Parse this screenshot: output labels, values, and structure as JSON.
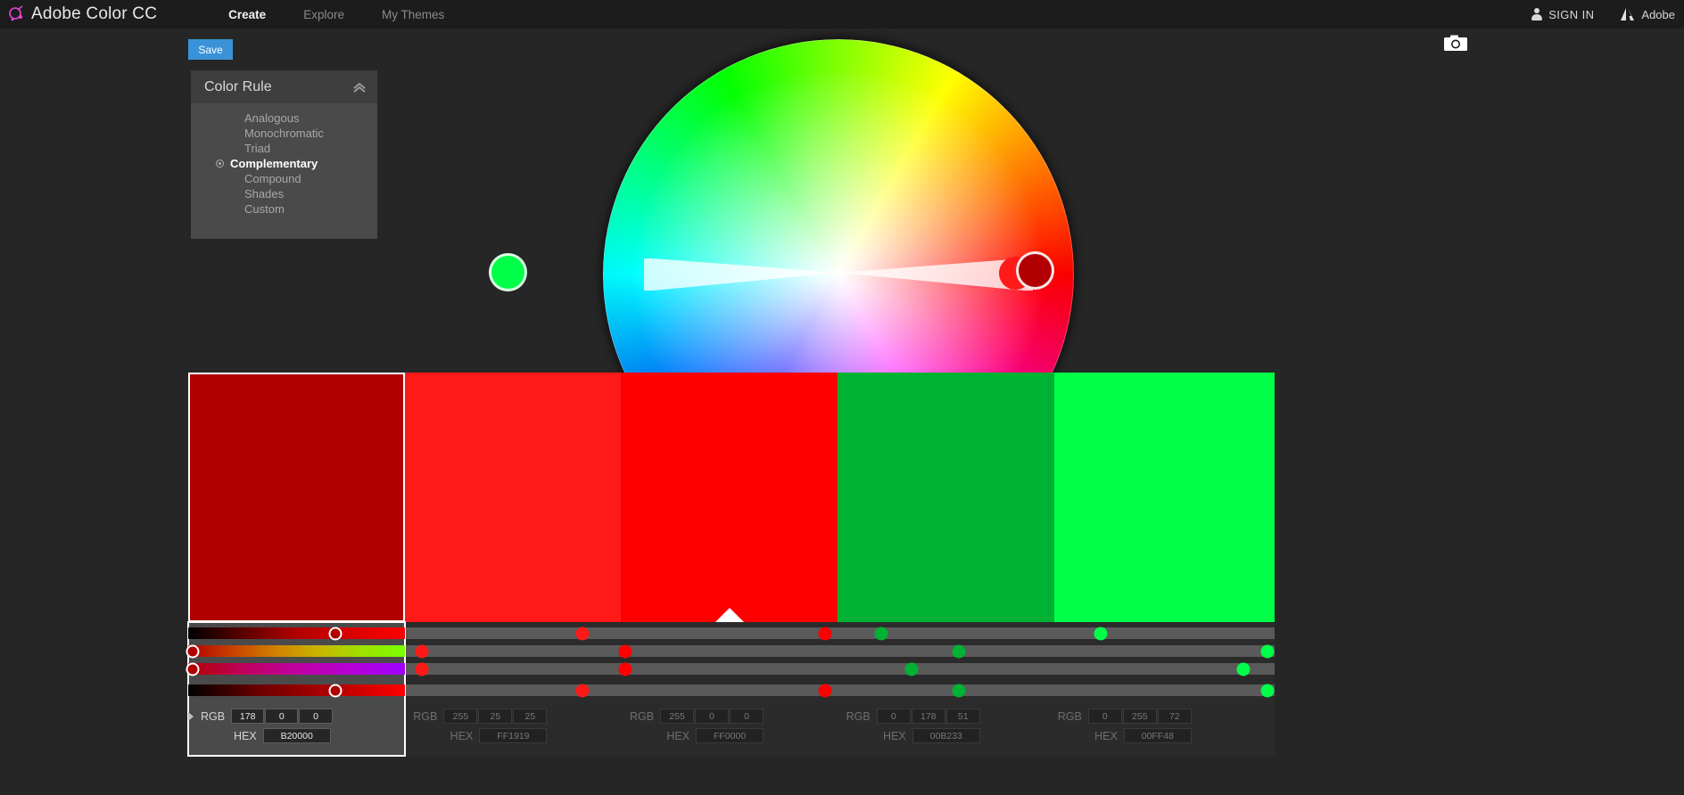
{
  "nav": {
    "brand": "Adobe Color CC",
    "brand_logo_icon": "adobe-color-logo-icon",
    "links": [
      {
        "label": "Create",
        "active": true
      },
      {
        "label": "Explore",
        "active": false
      },
      {
        "label": "My Themes",
        "active": false
      }
    ],
    "sign_in": "SIGN IN",
    "sign_in_icon": "person-icon",
    "adobe": "Adobe",
    "adobe_icon": "adobe-logo-icon"
  },
  "toolbar": {
    "save_label": "Save",
    "save_color": "#3a93d8",
    "camera_icon": "camera-icon"
  },
  "rule_panel": {
    "title": "Color Rule",
    "collapse_icon": "chevron-up-icon",
    "selected": "Complementary",
    "items": [
      {
        "label": "Analogous"
      },
      {
        "label": "Monochromatic"
      },
      {
        "label": "Triad"
      },
      {
        "label": "Complementary"
      },
      {
        "label": "Compound"
      },
      {
        "label": "Shades"
      },
      {
        "label": "Custom"
      }
    ]
  },
  "wheel": {
    "name": "color-wheel",
    "markers": [
      {
        "name": "marker-green",
        "hex": "#00FF48",
        "angle_deg": 178,
        "radius_pct": 89
      },
      {
        "name": "marker-red-bright",
        "hex": "#FF1919",
        "angle_deg": 358,
        "radius_pct": 80
      },
      {
        "name": "marker-red-dark",
        "hex": "#B20000",
        "angle_deg": 358,
        "radius_pct": 92
      }
    ]
  },
  "swatches": [
    {
      "name": "swatch-1",
      "hex": "#B20000",
      "rgb": [
        "178",
        "0",
        "0"
      ],
      "hex_text": "B20000",
      "selected": true,
      "base": false,
      "width_pct": 16.6
    },
    {
      "name": "swatch-2",
      "hex": "#FF1919",
      "rgb": [
        "255",
        "25",
        "25"
      ],
      "hex_text": "FF1919",
      "selected": false,
      "base": false,
      "width_pct": 16.6
    },
    {
      "name": "swatch-3",
      "hex": "#FF0000",
      "rgb": [
        "255",
        "0",
        "0"
      ],
      "hex_text": "FF0000",
      "selected": false,
      "base": true,
      "width_pct": 16.6
    },
    {
      "name": "swatch-4",
      "hex": "#00B233",
      "rgb": [
        "0",
        "178",
        "51"
      ],
      "hex_text": "00B233",
      "selected": false,
      "base": false,
      "width_pct": 16.6
    },
    {
      "name": "swatch-5",
      "hex": "#00FF48",
      "rgb": [
        "0",
        "255",
        "72"
      ],
      "hex_text": "00FF48",
      "selected": false,
      "base": false,
      "width_pct": 16.6
    }
  ],
  "value_labels": {
    "rgb": "RGB",
    "hex": "HEX"
  },
  "sliders": {
    "rows": [
      "brightness-slider",
      "hue-slider",
      "saturation-slider",
      "value-slider"
    ],
    "columns": [
      {
        "column": 1,
        "active": true,
        "knobs": [
          {
            "row": 0,
            "pos_pct": 68,
            "color": "#B20000"
          },
          {
            "row": 1,
            "pos_pct": 2,
            "color": "#B20000"
          },
          {
            "row": 2,
            "pos_pct": 2,
            "color": "#B20000"
          },
          {
            "row": 3,
            "pos_pct": 68,
            "color": "#B20000"
          }
        ],
        "gradients": [
          "linear-gradient(90deg,#000000,#B20000,#ff0000)",
          "linear-gradient(90deg,#B20000,#c84000,#d08000,#c9b400,#9fe000,#7bff00)",
          "linear-gradient(90deg,#B20000,#c0005a,#c000a0,#b500d8,#a000ff)",
          "linear-gradient(90deg,#000000,#6e0000,#B20000,#ff0000)"
        ]
      },
      {
        "column": 2,
        "active": false,
        "dots": [
          {
            "row": 0,
            "pos_pct": 82,
            "color": "#FF1919"
          },
          {
            "row": 1,
            "pos_pct": 8,
            "color": "#FF1919"
          },
          {
            "row": 2,
            "pos_pct": 8,
            "color": "#FF1919"
          },
          {
            "row": 3,
            "pos_pct": 82,
            "color": "#FF1919"
          }
        ]
      },
      {
        "column": 3,
        "active": false,
        "dots": [
          {
            "row": 0,
            "pos_pct": 94,
            "color": "#FF0000"
          },
          {
            "row": 1,
            "pos_pct": 2,
            "color": "#FF0000"
          },
          {
            "row": 2,
            "pos_pct": 2,
            "color": "#FF0000"
          },
          {
            "row": 3,
            "pos_pct": 94,
            "color": "#FF0000"
          }
        ]
      },
      {
        "column": 4,
        "active": false,
        "dots": [
          {
            "row": 0,
            "pos_pct": 20,
            "color": "#00B233"
          },
          {
            "row": 1,
            "pos_pct": 56,
            "color": "#00B233"
          },
          {
            "row": 2,
            "pos_pct": 34,
            "color": "#00B233"
          },
          {
            "row": 3,
            "pos_pct": 56,
            "color": "#00B233"
          }
        ]
      },
      {
        "column": 5,
        "active": false,
        "dots": [
          {
            "row": 0,
            "pos_pct": 21,
            "color": "#00FF48"
          },
          {
            "row": 1,
            "pos_pct": 97,
            "color": "#00FF48"
          },
          {
            "row": 2,
            "pos_pct": 86,
            "color": "#00FF48"
          },
          {
            "row": 3,
            "pos_pct": 97,
            "color": "#00FF48"
          }
        ]
      }
    ]
  },
  "colors": {
    "page_bg": "#262626",
    "topbar_bg": "#1c1c1c",
    "panel_bg": "#4a4a4a",
    "panel_header_bg": "#3e3e3e",
    "accent": "#3a93d8",
    "track_inactive": "#5a5a5a"
  }
}
